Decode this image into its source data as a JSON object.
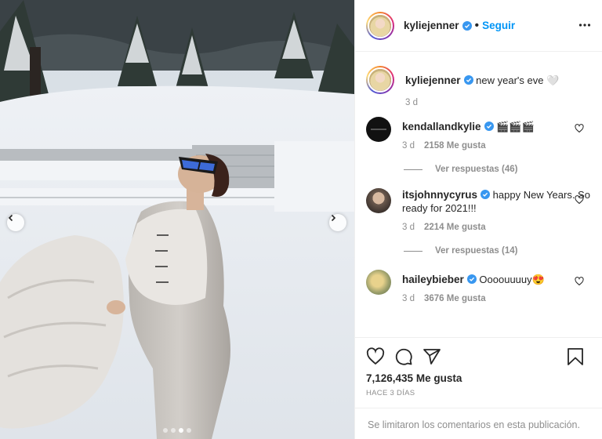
{
  "post": {
    "username": "kyliejenner",
    "follow_label": "Seguir",
    "caption": "new year's eve 🤍",
    "caption_time": "3 d",
    "likes_count": "7,126,435",
    "likes_label": "Me gusta",
    "posted": "HACE 3 DÍAS",
    "comments_limited": "Se limitaron los comentarios en esta publicación.",
    "carousel": {
      "slides": 4,
      "active_index": 2
    }
  },
  "comments": [
    {
      "username": "kendallandkylie",
      "text": "🎬🎬🎬",
      "time": "3 d",
      "likes": "2158 Me gusta",
      "replies": "Ver respuestas (46)"
    },
    {
      "username": "itsjohnnycyrus",
      "text": "happy New Years. So ready for 2021!!!",
      "time": "3 d",
      "likes": "2214 Me gusta",
      "replies": "Ver respuestas (14)"
    },
    {
      "username": "haileybieber",
      "text": "Oooouuuuy😍",
      "time": "3 d",
      "likes": "3676 Me gusta",
      "replies": ""
    }
  ],
  "icons": {
    "more": "more-options-icon",
    "verified": "verified-badge-icon",
    "like": "heart-icon",
    "comment": "comment-icon",
    "share": "share-icon",
    "save": "bookmark-icon",
    "prev": "chevron-left-icon",
    "next": "chevron-right-icon"
  },
  "colors": {
    "link": "#0095f6",
    "verified": "#3897f0",
    "muted": "#8e8e8e",
    "text": "#262626"
  }
}
